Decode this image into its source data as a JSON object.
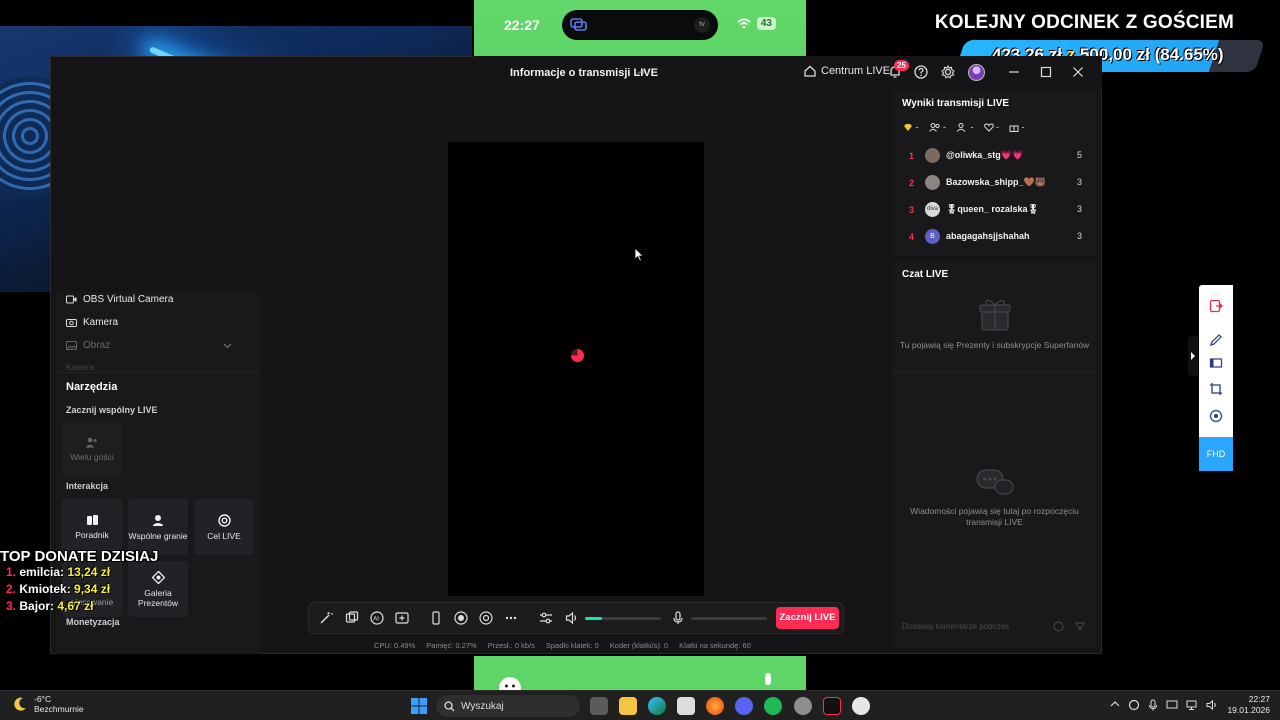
{
  "phone": {
    "time": "22:27",
    "battery": "43"
  },
  "banner": {
    "title": "KOLEJNY ODCINEK Z GOŚCIEM",
    "amount": "423,26 zł",
    "connector": "z",
    "goal": "500,00 zł",
    "percent": "(84.65%)",
    "progress": 0.8465,
    "accent": "#25b6ff"
  },
  "window": {
    "title": "Informacje o transmisji LIVE",
    "centrum_label": "Centrum LIVE",
    "notifications": "25"
  },
  "sources": {
    "obs": "OBS Virtual Camera",
    "kamera": "Kamera",
    "obraz": "Obraz",
    "kamera2": "Kamera"
  },
  "tools": {
    "title": "Narzędzia",
    "section_coop": "Zacznij wspólny LIVE",
    "multi_guest": "Wielu gości",
    "section_interaction": "Interakcja",
    "poradnik": "Poradnik",
    "wspolne_granie": "Wspólne granie",
    "cel_live": "Cel LIVE",
    "glosowanie": "głosowanie",
    "galeria": "Galeria Prezentów",
    "section_monetization": "Monetyzacja"
  },
  "toolbar": {
    "go_live": "Zacznij LIVE",
    "volume": 0.22,
    "accent": "#fe2c55"
  },
  "stats": {
    "cpu": "CPU: 0.49%",
    "memory": "Pamięć: 0.27%",
    "sent": "Przesł.: 0 kb/s",
    "dropped": "Spadki klatek: 0",
    "encoder": "Koder (klatki/s): 0",
    "fps": "Klatki na sekundę: 60"
  },
  "results": {
    "title": "Wyniki transmisji LIVE",
    "rows": [
      {
        "rank": "1",
        "name": "@oliwka_stg💗💗",
        "score": "5",
        "avatar": "",
        "color": "#7a6a60"
      },
      {
        "rank": "2",
        "name": "Bazowska_shipp_🤎🐻",
        "score": "3",
        "avatar": "",
        "color": "#8a8580"
      },
      {
        "rank": "3",
        "name": "🎖queen_ rozalska🎖",
        "score": "3",
        "avatar": "diva",
        "color": "#d9d9d9"
      },
      {
        "rank": "4",
        "name": "abagagahsjjshahah",
        "score": "3",
        "avatar": "B",
        "color": "#5b5fc7"
      }
    ]
  },
  "chat": {
    "title": "Czat LIVE",
    "gifts_info": "Tu pojawią się Prezenty i subskrypcje Superfanów",
    "messages_info": "Wiadomości pojawią się tutaj po rozpoczęciu transmisji LIVE",
    "input_placeholder": "Dodawaj komentarze podczas"
  },
  "sidebar": {
    "quality": "FHD"
  },
  "donate": {
    "title": "TOP DONATE DZISIAJ",
    "donors": [
      {
        "n": "1.",
        "name": "emilcia:",
        "amount": "13,24 zł"
      },
      {
        "n": "2.",
        "name": "Kmiotek:",
        "amount": "9,34 zł"
      },
      {
        "n": "3.",
        "name": "Bajor:",
        "amount": "4,67 zł"
      }
    ]
  },
  "taskbar": {
    "temp": "-6°C",
    "weather": "Bezchmurnie",
    "search": "Wyszukaj",
    "time": "22:27",
    "date": "19.01.2026"
  }
}
